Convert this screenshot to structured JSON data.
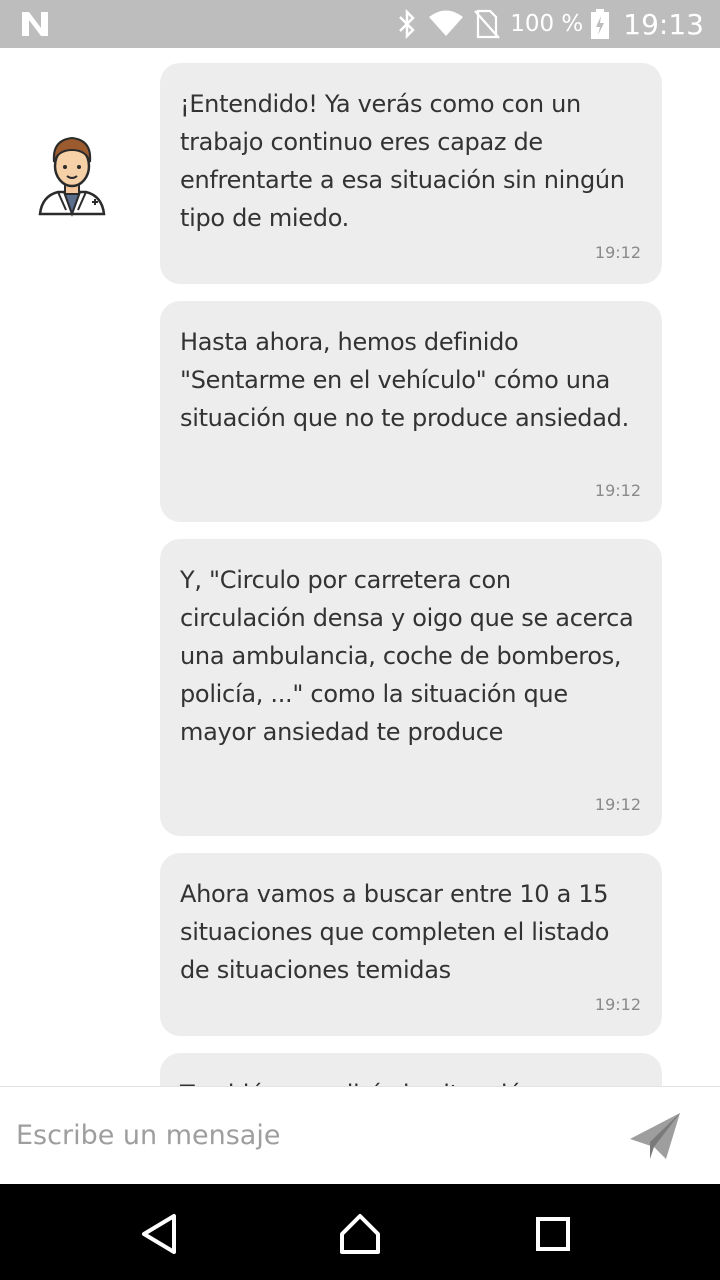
{
  "status_bar": {
    "battery_percent": "100 %",
    "clock": "19:13",
    "icons": [
      "notification-n-icon",
      "bluetooth-icon",
      "wifi-icon",
      "no-sim-icon",
      "battery-charging-icon"
    ]
  },
  "chat": {
    "assistant_avatar": "doctor-avatar-icon",
    "messages": [
      {
        "text": "¡Entendido! Ya verás como con un trabajo continuo eres capaz de enfrentarte a esa situación sin ningún tipo de miedo.",
        "time": "19:12"
      },
      {
        "text": "Hasta ahora, hemos definido \"Sentarme en el vehículo\" cómo una situación que no te produce ansiedad.",
        "time": "19:12"
      },
      {
        "text": "Y, \"Circulo por carretera con circulación densa y oigo que se acerca una ambulancia, coche de bomberos, policía, ...\" como la situación que mayor ansiedad te produce",
        "time": "19:12"
      },
      {
        "text": "Ahora vamos a buscar entre 10 a 15 situaciones que completen el listado de situaciones temidas",
        "time": "19:12"
      },
      {
        "text": "También, me dirás la situación",
        "time": ""
      }
    ]
  },
  "composer": {
    "placeholder": "Escribe un mensaje",
    "value": ""
  },
  "nav_bar": {
    "buttons": [
      "back-icon",
      "home-icon",
      "recents-icon"
    ]
  },
  "colors": {
    "status_bar": "#bdbdbd",
    "bubble": "#ededed",
    "text": "#333333",
    "time": "#8a8a8a",
    "nav_bar": "#000000"
  }
}
